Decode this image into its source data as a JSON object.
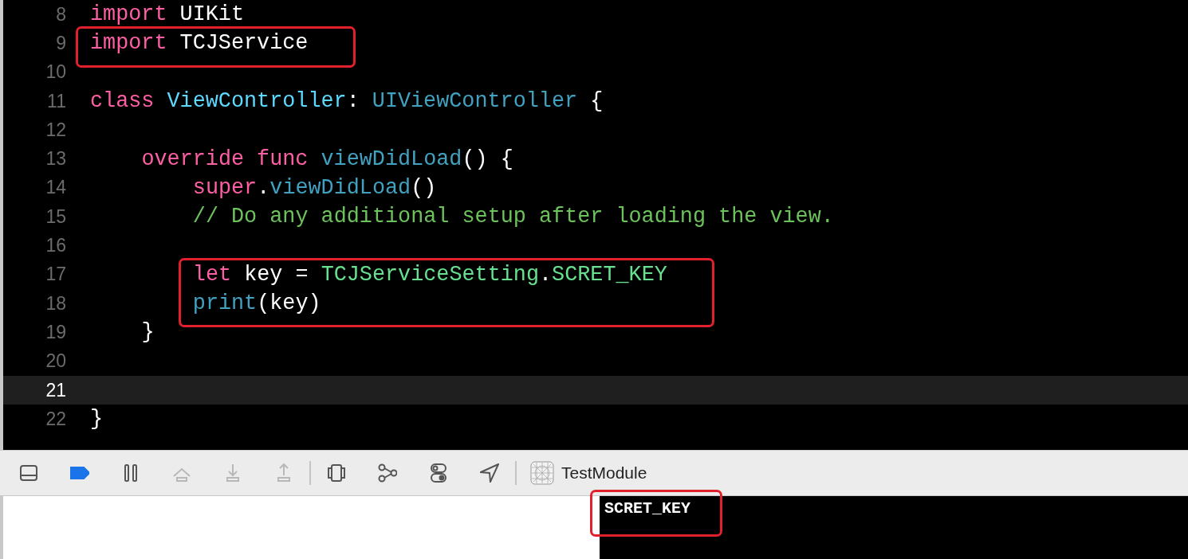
{
  "editor": {
    "lines": [
      {
        "number": "8",
        "current": false,
        "boxed": false,
        "kind": "top",
        "tokens": [
          {
            "text": "import",
            "kind": "keyword"
          },
          {
            "text": " UIKit",
            "kind": "plain"
          }
        ]
      },
      {
        "number": "9",
        "current": false,
        "boxed": true,
        "kind": "top",
        "tokens": [
          {
            "text": "import",
            "kind": "keyword"
          },
          {
            "text": " TCJService",
            "kind": "plain"
          }
        ]
      },
      {
        "number": "10",
        "current": false,
        "boxed": false,
        "kind": "top"
      },
      {
        "number": "11",
        "current": false,
        "boxed": false,
        "kind": "top",
        "tokens": [
          {
            "text": "class",
            "kind": "keyword"
          },
          {
            "text": " ViewController",
            "kind": "type-decl"
          },
          {
            "text": ": ",
            "kind": "plain"
          },
          {
            "text": "UIViewController",
            "kind": "type"
          },
          {
            "text": " {",
            "kind": "plain"
          }
        ]
      },
      {
        "number": "12",
        "current": false,
        "boxed": false,
        "kind": "top"
      },
      {
        "number": "13",
        "current": false,
        "boxed": false,
        "kind": "member",
        "tokens": [
          {
            "text": "override func",
            "kind": "keyword"
          },
          {
            "text": " viewDidLoad",
            "kind": "func"
          },
          {
            "text": "() {",
            "kind": "plain"
          }
        ]
      },
      {
        "number": "14",
        "current": false,
        "boxed": false,
        "kind": "body",
        "tokens": [
          {
            "text": "super",
            "kind": "keyword"
          },
          {
            "text": ".",
            "kind": "plain"
          },
          {
            "text": "viewDidLoad",
            "kind": "func"
          },
          {
            "text": "()",
            "kind": "plain"
          }
        ]
      },
      {
        "number": "15",
        "current": false,
        "boxed": false,
        "kind": "body",
        "tokens": [
          {
            "text": "// Do any additional setup after loading the view.",
            "kind": "comment"
          }
        ]
      },
      {
        "number": "16",
        "current": false,
        "boxed": false,
        "kind": "top"
      },
      {
        "number": "17",
        "current": false,
        "boxed": true,
        "kind": "body",
        "tokens": [
          {
            "text": "let",
            "kind": "keyword"
          },
          {
            "text": " key = ",
            "kind": "plain"
          },
          {
            "text": "TCJServiceSetting",
            "kind": "project"
          },
          {
            "text": ".",
            "kind": "plain"
          },
          {
            "text": "SCRET_KEY",
            "kind": "project"
          }
        ]
      },
      {
        "number": "18",
        "current": false,
        "boxed": true,
        "kind": "body",
        "tokens": [
          {
            "text": "print",
            "kind": "func"
          },
          {
            "text": "(key)",
            "kind": "plain"
          }
        ]
      },
      {
        "number": "19",
        "current": false,
        "boxed": false,
        "kind": "member",
        "tokens": [
          {
            "text": "}",
            "kind": "plain"
          }
        ]
      },
      {
        "number": "20",
        "current": false,
        "boxed": false,
        "kind": "top"
      },
      {
        "number": "21",
        "current": true,
        "boxed": false,
        "kind": "top"
      },
      {
        "number": "22",
        "current": false,
        "boxed": false,
        "kind": "top",
        "tokens": [
          {
            "text": "}",
            "kind": "plain"
          }
        ]
      }
    ]
  },
  "debug_bar": {
    "groups": [
      [
        {
          "kind": "panel",
          "disabled": false
        },
        {
          "kind": "breakpoint",
          "on": true,
          "disabled": false
        },
        {
          "kind": "pause",
          "disabled": false
        },
        {
          "kind": "step-over",
          "disabled": true
        },
        {
          "kind": "step-into",
          "disabled": true
        },
        {
          "kind": "step-out",
          "disabled": true
        }
      ],
      [
        {
          "kind": "view-debug",
          "disabled": false
        },
        {
          "kind": "graph",
          "disabled": false
        },
        {
          "kind": "toggles",
          "disabled": false
        },
        {
          "kind": "location",
          "disabled": false
        }
      ]
    ],
    "target": "TestModule"
  },
  "console": {
    "output": "SCRET_KEY",
    "boxed": true
  }
}
